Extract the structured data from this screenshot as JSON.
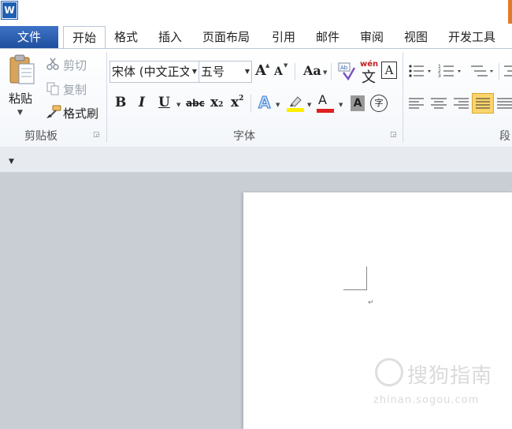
{
  "app": {
    "logo_letter": "W"
  },
  "tabs": {
    "file": "文件",
    "items": [
      "开始",
      "格式",
      "插入",
      "页面布局",
      "引用",
      "邮件",
      "审阅",
      "视图",
      "开发工具"
    ]
  },
  "clipboard": {
    "paste": "粘贴",
    "cut": "剪切",
    "copy": "复制",
    "format_painter": "格式刷",
    "group_label": "剪贴板"
  },
  "font": {
    "font_name": "宋体 (中文正文",
    "font_size": "五号",
    "grow": "A",
    "shrink": "A",
    "change_case": "Aa",
    "phonetic": "wén",
    "phonetic_char": "文",
    "char_border": "A",
    "bold": "B",
    "italic": "I",
    "underline": "U",
    "strikethrough": "abc",
    "subscript": "x",
    "subscript_mark": "2",
    "superscript": "x",
    "superscript_mark": "2",
    "text_effect": "A",
    "font_color": "A",
    "char_shading": "A",
    "enclose_char": "字",
    "group_label": "字体"
  },
  "paragraph": {
    "group_label": "段"
  },
  "document": {
    "paragraph_mark": "↵"
  },
  "watermark": {
    "brand": "搜狗指南",
    "url": "zhinan.sogou.com"
  },
  "colors": {
    "file_tab": "#2a5aa8",
    "accent_orange": "#e07b2a",
    "highlight_yellow": "#ffee00",
    "font_color_red": "#e02020",
    "justify_active": "#fbd56b"
  }
}
